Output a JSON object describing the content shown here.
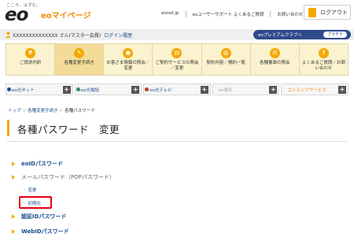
{
  "header": {
    "logo_sub": "こころ、はずむ。",
    "logo": "eo",
    "title": "eoマイページ",
    "links": [
      "eonet.jp",
      "eoユーザーサポート よくあるご質問",
      "お問い合わせ"
    ],
    "logout_label": "ログアウト"
  },
  "userbar": {
    "user_text": "XXXXXXXXXXXXXX さん(マスター会員)",
    "login_history": "ログイン履歴",
    "premium_label": "eoプレミアムクラブへ",
    "premium_badge": "プラチナ"
  },
  "nav": [
    {
      "label": "ご請求内訳",
      "icon": "yen-icon",
      "glyph": "¥"
    },
    {
      "label": "各種変更手続き",
      "icon": "pencil-icon",
      "glyph": "✎"
    },
    {
      "label": "お客さま情報の照会／変更",
      "icon": "person-icon",
      "glyph": "●"
    },
    {
      "label": "ご契約サービスの照会／変更",
      "icon": "document-icon",
      "glyph": "▤"
    },
    {
      "label": "契約内容／規約一覧",
      "icon": "book-icon",
      "glyph": "▥"
    },
    {
      "label": "各種書面の照会",
      "icon": "envelope-icon",
      "glyph": "✉"
    },
    {
      "label": "よくあるご質問／お問い合わせ",
      "icon": "question-icon",
      "glyph": "?"
    }
  ],
  "services": [
    {
      "label": "eo光ネット",
      "color": "#1a4d8f"
    },
    {
      "label": "eo光電話",
      "color": "#1a4d8f"
    },
    {
      "label": "eo光テレビ",
      "color": "#1a4d8f"
    },
    {
      "label": "eo電気",
      "color": "#aaaaaa"
    },
    {
      "label": "コンテンツサービス",
      "color": "#f28c00"
    }
  ],
  "breadcrumb": {
    "items": [
      "トップ",
      "各種変更手続き",
      "各種パスワード"
    ]
  },
  "page_title": "各種パスワード　変更",
  "list": {
    "eoid": "eoIDパスワード",
    "mail": "メールパスワード（POPパスワード）",
    "mail_change": "変更",
    "mail_init": "初期化",
    "auth": "認証IDパスワード",
    "webid": "WebIDパスワード"
  },
  "colors": {
    "accent": "#f5a800",
    "link": "#1a4d8f",
    "highlight": "#e60012",
    "premium": "#2f4a8c"
  }
}
